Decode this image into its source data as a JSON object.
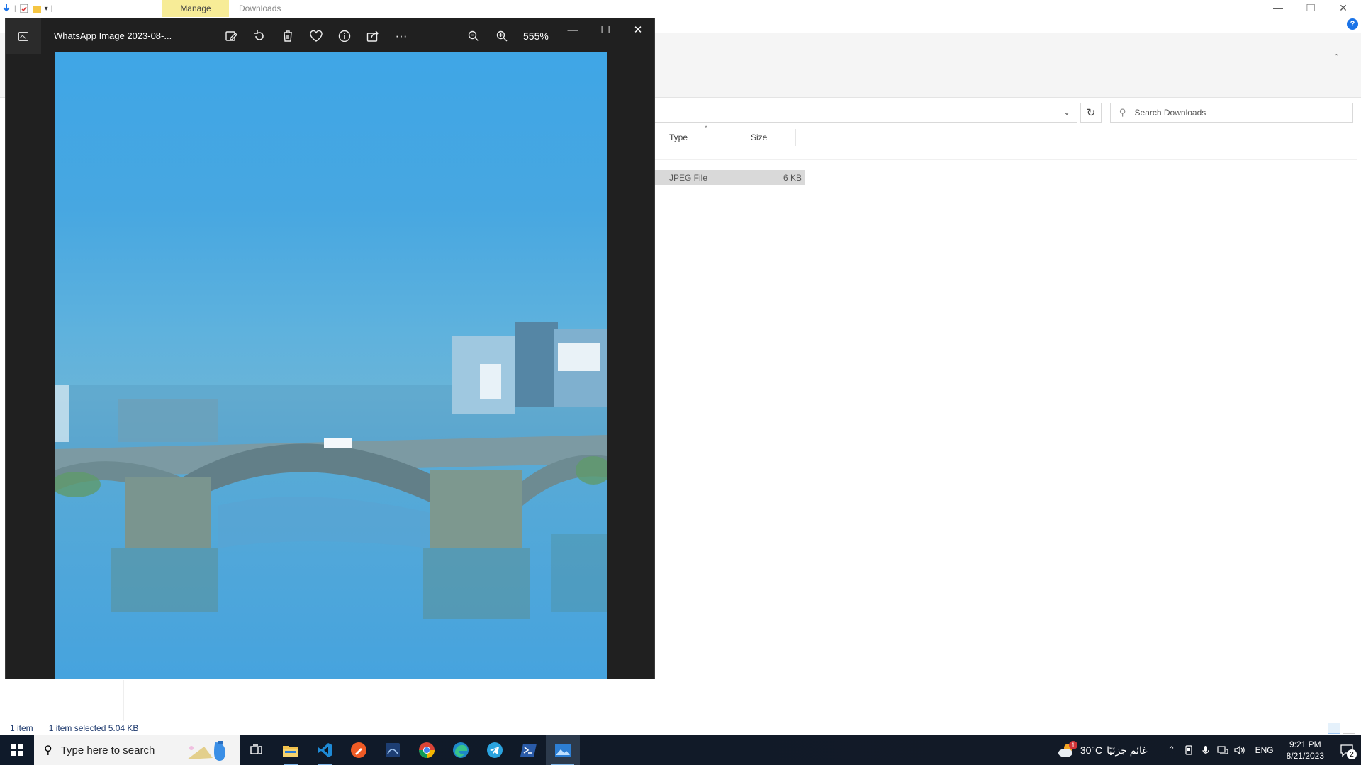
{
  "explorer": {
    "ribbon_contextual_tab": "Manage",
    "window_title": "Downloads",
    "search_placeholder": "Search Downloads",
    "columns": [
      "Type",
      "Size"
    ],
    "file_row": {
      "type": "JPEG File",
      "size": "6 KB"
    },
    "status": {
      "item_count": "1 item",
      "selection": "1 item selected  5.04 KB"
    }
  },
  "photos": {
    "filename": "WhatsApp Image 2023-08-...",
    "zoom_label": "555%",
    "toolbar": [
      "edit-image",
      "rotate",
      "delete",
      "favorite",
      "info",
      "share",
      "more"
    ]
  },
  "taskbar": {
    "search_placeholder": "Type here to search",
    "apps": [
      "task-view",
      "file-explorer",
      "vs-code",
      "postman",
      "wireshark",
      "chrome",
      "edge",
      "telegram",
      "powershell",
      "photos"
    ],
    "weather_temp": "30°C",
    "weather_text": "غائم جزئيًا",
    "weather_badge": "1",
    "language": "ENG",
    "time": "9:21 PM",
    "date": "8/21/2023",
    "notification_count": "2"
  },
  "colors": {
    "manage_tab": "#f7ec97",
    "photos_bg": "#202020",
    "taskbar_bg": "#131a26",
    "selection": "#d9d9d9"
  }
}
